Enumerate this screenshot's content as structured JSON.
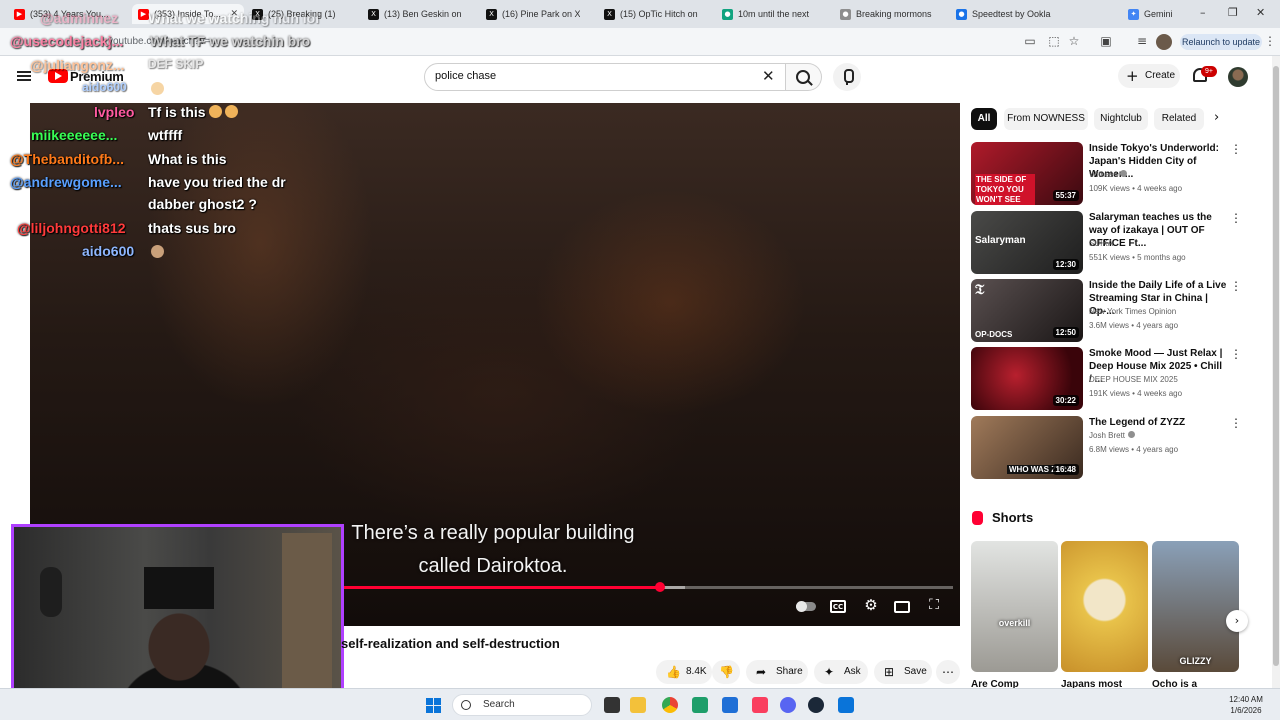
{
  "browser": {
    "tabs": [
      {
        "label": "(353) 4 Years You...",
        "icon_color": "#ff0000"
      },
      {
        "label": "(353) Inside To...",
        "icon_color": "#ff0000"
      },
      {
        "label": "(25) Breaking (1)",
        "icon_color": "#111111"
      },
      {
        "label": "(13) Ben Geskin on",
        "icon_color": "#111111"
      },
      {
        "label": "(16) Pine Park on X",
        "icon_color": "#111111"
      },
      {
        "label": "(15) OpTic Hitch on",
        "icon_color": "#111111"
      },
      {
        "label": "10m until the next",
        "icon_color": "#10a37f"
      },
      {
        "label": "Breaking mormons",
        "icon_color": "#8e8e8e"
      },
      {
        "label": "Speedtest by Ookla",
        "icon_color": "#1a73e8"
      },
      {
        "label": "Gemini",
        "icon_color": "#4285f4"
      }
    ],
    "url": "youtube.com/watch?v=...",
    "relaunch_label": "Relaunch to update"
  },
  "youtube": {
    "premium_label": "Premium",
    "search": {
      "value": "police chase",
      "placeholder": "Search"
    },
    "create_label": "Create",
    "notification_count": "9+"
  },
  "player": {
    "subtitle_line1": "There’s a really popular building",
    "subtitle_line2": "called Dairoktoa.",
    "progress_played": 0.52,
    "progress_buffered": 0.56
  },
  "chat": [
    {
      "user": "@adminnez",
      "msg": "What we watching huh lol",
      "color": "#ff5c8a",
      "faded": true
    },
    {
      "user": "@usecodejackj...",
      "msg": "What TF we watchin bro",
      "color": "#ff5c8a",
      "faded": true
    },
    {
      "user": "@juliangonz...",
      "msg": "DEF SKIP",
      "color": "#ff7a1a",
      "faded": true
    },
    {
      "user": "aido600",
      "msg": "",
      "color": "#6ea8ff",
      "faded": true
    },
    {
      "user": "lvpleo",
      "msg": "Tf is this",
      "color": "#ff5aa0",
      "faded": false
    },
    {
      "user": "miikeeeeee...",
      "msg": "wtffff",
      "color": "#39ff55",
      "faded": false
    },
    {
      "user": "@Thebanditofb...",
      "msg": "What is this",
      "color": "#ff7a1a",
      "faded": false
    },
    {
      "user": "@andrewgome...",
      "msg": "have you tried the dr",
      "msg2": "dabber ghost2 ?",
      "color": "#5aa0ff",
      "faded": false
    },
    {
      "user": "@liljohngotti812",
      "msg": "thats sus bro",
      "color": "#ff3b3b",
      "faded": false
    },
    {
      "user": "aido600",
      "msg": "",
      "color": "#8fb7ff",
      "faded": false
    }
  ],
  "video": {
    "title": "self-realization and self-destruction",
    "likes": "8.4K",
    "share_label": "Share",
    "ask_label": "Ask",
    "save_label": "Save"
  },
  "chips": [
    "All",
    "From NOWNESS",
    "Nightclub",
    "Related"
  ],
  "recommendations": [
    {
      "title": "Inside Tokyo's Underworld: Japan's Hidden City of Women...",
      "channel": "Witness",
      "verified": true,
      "meta": "109K views • 4 weeks ago",
      "duration": "55:37",
      "thumb_label": "THE SIDE OF TOKYO YOU WON'T SEE",
      "thumb_color": "#5a1a1a"
    },
    {
      "title": "Salaryman teaches us the way of izakaya | OUT OF OFFICE Ft...",
      "channel": "SUIKA",
      "verified": false,
      "meta": "551K views • 5 months ago",
      "duration": "12:30",
      "thumb_label": "Salaryman",
      "thumb_color": "#3a3a3a"
    },
    {
      "title": "Inside the Daily Life of a Live Streaming Star in China | Op-...",
      "channel": "New York Times Opinion",
      "verified": false,
      "meta": "3.6M views • 4 years ago",
      "duration": "12:50",
      "thumb_label": "OP-DOCS",
      "thumb_color": "#2e2a2a"
    },
    {
      "title": "Smoke Mood — Just Relax | Deep House Mix 2025 • Chill / ...",
      "channel": "DEEP HOUSE MIX 2025",
      "verified": false,
      "meta": "191K views • 4 weeks ago",
      "duration": "30:22",
      "thumb_label": "",
      "thumb_color": "#6a0c14"
    },
    {
      "title": "The Legend of ZYZZ",
      "channel": "Josh Brett",
      "verified": true,
      "meta": "6.8M views • 4 years ago",
      "duration": "16:48",
      "thumb_label": "WHO WAS ZYZZ",
      "thumb_color": "#4a3a30"
    }
  ],
  "shorts": {
    "heading": "Shorts",
    "items": [
      {
        "label": "overkill",
        "title": "Are Comp",
        "color": "#c9c9c5"
      },
      {
        "label": "",
        "title": "Japans most",
        "color": "#e8c24a"
      },
      {
        "label": "GLIZZY",
        "title": "Ocho is a",
        "color": "#8a7a6a"
      }
    ]
  },
  "taskbar": {
    "search_label": "Search",
    "time": "12:40 AM",
    "date": "1/6/2026"
  },
  "colors": {
    "youtube_red": "#ff0000",
    "progress_red": "#ff0033",
    "webcam_border": "#b040ff"
  }
}
